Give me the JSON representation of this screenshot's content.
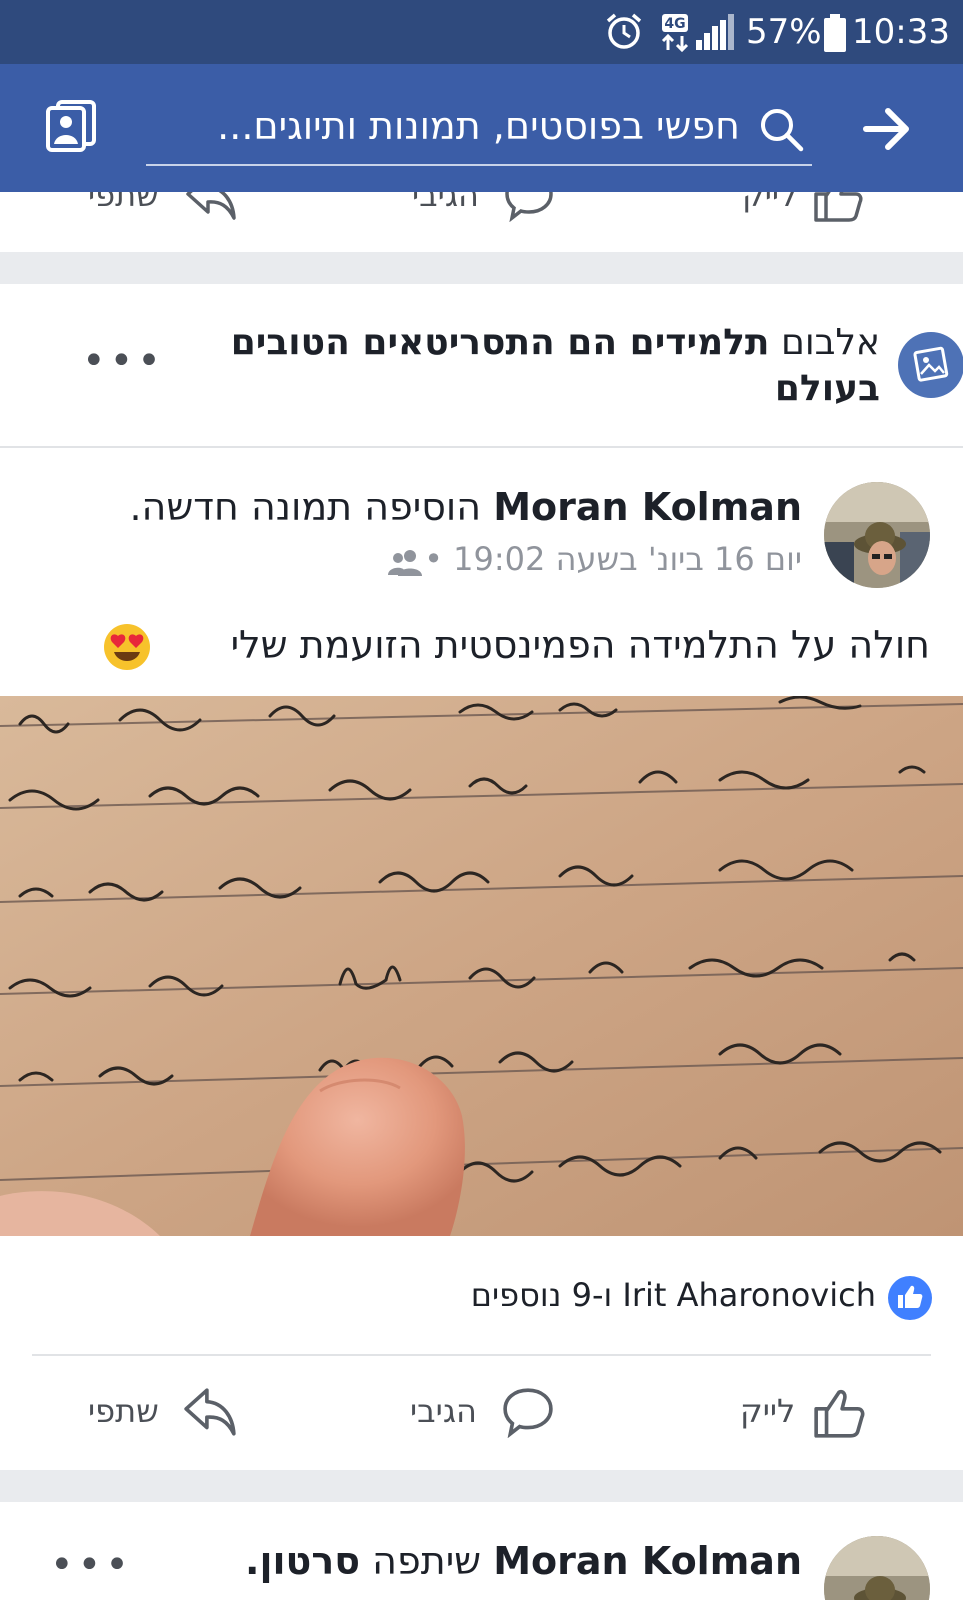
{
  "status_bar": {
    "network": "4G",
    "battery": "57%",
    "time": "10:33",
    "colors": {
      "background": "#2f4a7d",
      "text": "#ffffff"
    }
  },
  "app_bar": {
    "search_placeholder": "חפשי בפוסטים, תמונות ותיוגים...",
    "colors": {
      "background": "#3b5da7"
    },
    "icons": [
      "photos-icon",
      "search-icon",
      "back-arrow-icon"
    ]
  },
  "album_header": {
    "prefix": "אלבום",
    "name": "תלמידים הם התסריטאים הטובים בעולם"
  },
  "post": {
    "author": "Moran Kolman",
    "action": "הוסיפה תמונה חדשה.",
    "timestamp": "יום 16 ביונ' בשעה 19:02",
    "text": "חולה על התלמידה הפמינסטית הזועמת שלי",
    "emoji": "heart-eyes-emoji",
    "reactions_text": "Irit Aharonovich ו-9 נוספים",
    "actions": {
      "like": "לייק",
      "comment": "הגיבי",
      "share": "שתפי"
    }
  },
  "next_post": {
    "author": "Moran Kolman",
    "action_prefix": "שיתפה",
    "action_object": "סרטון."
  },
  "colors": {
    "separator": "#e9ebee",
    "accent": "#4080ff",
    "secondary_text": "#90949c"
  }
}
